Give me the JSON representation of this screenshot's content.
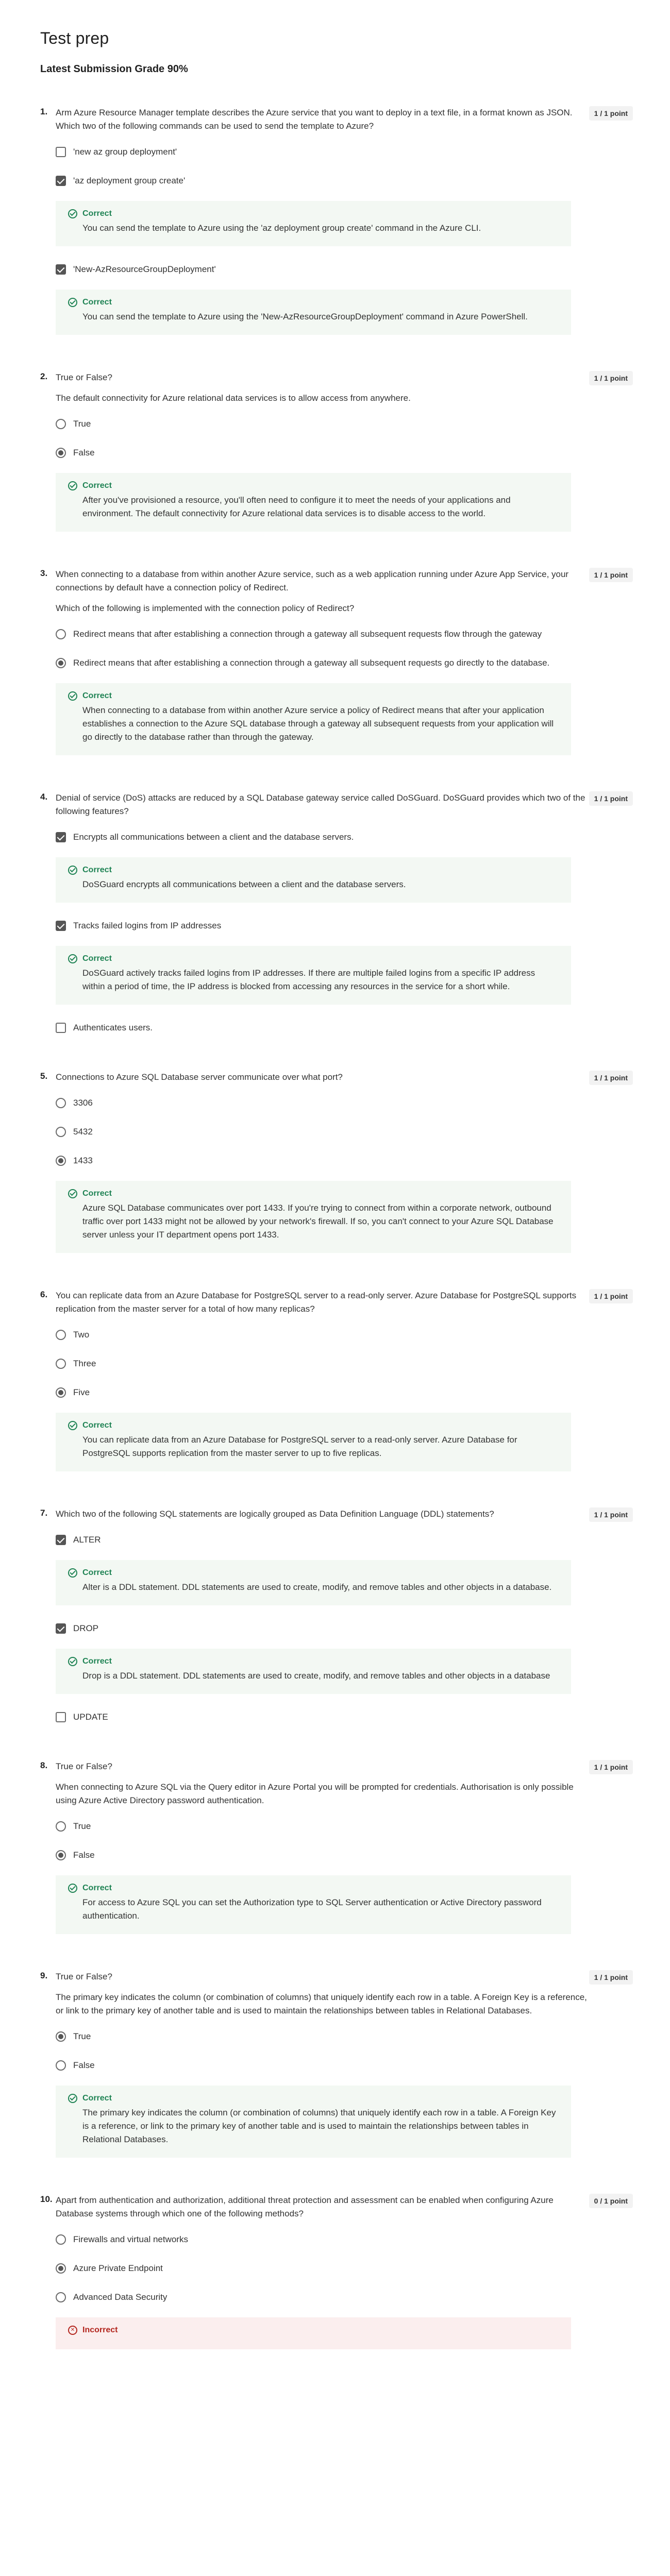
{
  "page": {
    "title": "Test prep",
    "grade": "Latest Submission Grade 90%"
  },
  "questions": [
    {
      "number": "1.",
      "points": "1 / 1 point",
      "type": "checkbox",
      "text": "Arm Azure Resource Manager template describes the Azure service that you want to deploy in a text file, in a format known as JSON. Which two of the following commands can be used to send the template to Azure?",
      "sub": "",
      "options": [
        {
          "label": "'new az group deployment'",
          "checked": false
        },
        {
          "label": "'az deployment group create'",
          "checked": true,
          "feedback": {
            "status": "correct",
            "title": "Correct",
            "text": "You can send the template to Azure using the 'az deployment group create' command in the Azure CLI."
          }
        },
        {
          "label": "'New-AzResourceGroupDeployment'",
          "checked": true,
          "feedback": {
            "status": "correct",
            "title": "Correct",
            "text": "You can send the template to Azure using the 'New-AzResourceGroupDeployment' command in Azure PowerShell."
          }
        }
      ]
    },
    {
      "number": "2.",
      "points": "1 / 1 point",
      "type": "radio",
      "text": "True or False?",
      "sub": "The default connectivity for Azure relational data services is to allow access from anywhere.",
      "options": [
        {
          "label": "True",
          "checked": false
        },
        {
          "label": "False",
          "checked": true,
          "feedback": {
            "status": "correct",
            "title": "Correct",
            "text": "After you've provisioned a resource, you'll often need to configure it to meet the needs of your applications and environment. The default connectivity for Azure relational data services is to disable access to the world."
          }
        }
      ]
    },
    {
      "number": "3.",
      "points": "1 / 1 point",
      "type": "radio",
      "text": "When connecting to a database from within another Azure service, such as a web application running under Azure App Service, your connections by default have a connection policy of Redirect.",
      "sub": "Which of the following is implemented with the connection policy of Redirect?",
      "options": [
        {
          "label": "Redirect means that after establishing a connection through a gateway all subsequent requests flow through the gateway",
          "checked": false
        },
        {
          "label": "Redirect means that after establishing a connection through a gateway all subsequent requests go directly to the database.",
          "checked": true,
          "feedback": {
            "status": "correct",
            "title": "Correct",
            "text": "When connecting to a database from within another Azure service a policy of Redirect means that after your application establishes a connection to the Azure SQL database through a gateway all subsequent requests from your application will go directly to the database rather than through the gateway."
          }
        }
      ]
    },
    {
      "number": "4.",
      "points": "1 / 1 point",
      "type": "checkbox",
      "text": "Denial of service (DoS) attacks are reduced by a SQL Database gateway service called DoSGuard. DoSGuard provides which two of the following features?",
      "sub": "",
      "options": [
        {
          "label": "Encrypts all communications between a client and the database servers.",
          "checked": true,
          "feedback": {
            "status": "correct",
            "title": "Correct",
            "text": "DoSGuard encrypts all communications between a client and the database servers."
          }
        },
        {
          "label": "Tracks failed logins from IP addresses",
          "checked": true,
          "feedback": {
            "status": "correct",
            "title": "Correct",
            "text": "DoSGuard actively tracks failed logins from IP addresses. If there are multiple failed logins from a specific IP address within a period of time, the IP address is blocked from accessing any resources in the service for a short while."
          }
        },
        {
          "label": "Authenticates users.",
          "checked": false
        }
      ]
    },
    {
      "number": "5.",
      "points": "1 / 1 point",
      "type": "radio",
      "text": "Connections to Azure SQL Database server communicate over what port?",
      "sub": "",
      "options": [
        {
          "label": "3306",
          "checked": false
        },
        {
          "label": "5432",
          "checked": false
        },
        {
          "label": "1433",
          "checked": true,
          "feedback": {
            "status": "correct",
            "title": "Correct",
            "text": "Azure SQL Database communicates over port 1433. If you're trying to connect from within a corporate network, outbound traffic over port 1433 might not be allowed by your network's firewall. If so, you can't connect to your Azure SQL Database server unless your IT department opens port 1433."
          }
        }
      ]
    },
    {
      "number": "6.",
      "points": "1 / 1 point",
      "type": "radio",
      "text": "You can replicate data from an Azure Database for PostgreSQL server to a read-only server. Azure Database for PostgreSQL supports replication from the master server for a total of how many replicas?",
      "sub": "",
      "options": [
        {
          "label": "Two",
          "checked": false
        },
        {
          "label": "Three",
          "checked": false
        },
        {
          "label": "Five",
          "checked": true,
          "feedback": {
            "status": "correct",
            "title": "Correct",
            "text": "You can replicate data from an Azure Database for PostgreSQL server to a read-only server. Azure Database for PostgreSQL supports replication from the master server to up to five replicas."
          }
        }
      ]
    },
    {
      "number": "7.",
      "points": "1 / 1 point",
      "type": "checkbox",
      "text": "Which two of the following SQL statements are logically grouped as Data Definition Language (DDL) statements?",
      "sub": "",
      "options": [
        {
          "label": "ALTER",
          "checked": true,
          "feedback": {
            "status": "correct",
            "title": "Correct",
            "text": "Alter is a DDL statement. DDL statements are used to create, modify, and remove tables and other objects in a database."
          }
        },
        {
          "label": "DROP",
          "checked": true,
          "feedback": {
            "status": "correct",
            "title": "Correct",
            "text": "Drop is a DDL statement. DDL statements are used to create, modify, and remove tables and other objects in a database"
          }
        },
        {
          "label": "UPDATE",
          "checked": false
        }
      ]
    },
    {
      "number": "8.",
      "points": "1 / 1 point",
      "type": "radio",
      "text": "True or False?",
      "sub": "When connecting to Azure SQL via the Query editor in Azure Portal you will be prompted for credentials. Authorisation is only possible using Azure Active Directory password authentication.",
      "options": [
        {
          "label": "True",
          "checked": false
        },
        {
          "label": "False",
          "checked": true,
          "feedback": {
            "status": "correct",
            "title": "Correct",
            "text": "For access to Azure SQL you can set the Authorization type to SQL Server authentication or Active Directory password authentication."
          }
        }
      ]
    },
    {
      "number": "9.",
      "points": "1 / 1 point",
      "type": "radio",
      "text": "True or False?",
      "sub": "The primary key indicates the column (or combination of columns) that uniquely identify each row in a table. A Foreign Key is a reference, or link to the primary key of another table and is used to maintain the relationships between tables in Relational Databases.",
      "options": [
        {
          "label": "True",
          "checked": true
        },
        {
          "label": "False",
          "checked": false,
          "feedback": {
            "status": "correct",
            "title": "Correct",
            "text": "The primary key indicates the column (or combination of columns) that uniquely identify each row in a table. A Foreign Key is a reference, or link to the primary key of another table and is used to maintain the relationships between tables in Relational Databases."
          }
        }
      ]
    },
    {
      "number": "10.",
      "points": "0 / 1 point",
      "type": "radio",
      "text": "Apart from authentication and authorization, additional threat protection and assessment can be enabled when configuring Azure Database systems through which one of the following methods?",
      "sub": "",
      "options": [
        {
          "label": "Firewalls and virtual networks",
          "checked": false
        },
        {
          "label": "Azure Private Endpoint",
          "checked": true
        },
        {
          "label": "Advanced Data Security",
          "checked": false,
          "feedback": {
            "status": "incorrect",
            "title": "Incorrect",
            "text": ""
          }
        }
      ]
    }
  ]
}
